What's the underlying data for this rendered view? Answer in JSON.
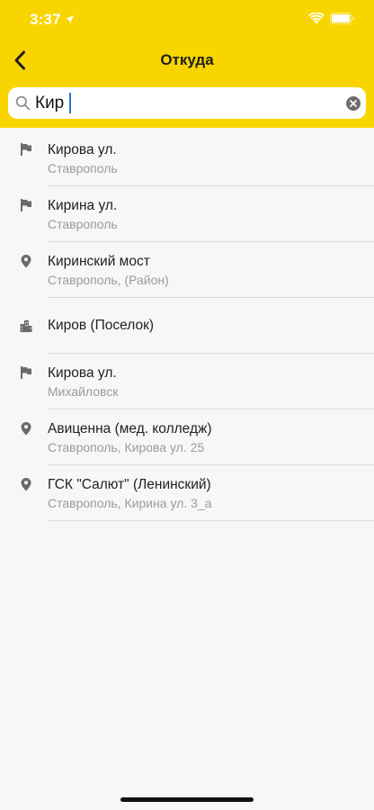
{
  "status_bar": {
    "time": "3:37"
  },
  "nav": {
    "title": "Откуда"
  },
  "search": {
    "value": "Кир"
  },
  "results": [
    {
      "icon": "flag-icon",
      "title": "Кирова ул.",
      "subtitle": "Ставрополь"
    },
    {
      "icon": "flag-icon",
      "title": "Кирина ул.",
      "subtitle": "Ставрополь"
    },
    {
      "icon": "pin-icon",
      "title": "Киринский мост",
      "subtitle": "Ставрополь, (Район)"
    },
    {
      "icon": "city-icon",
      "title": "Киров (Поселок)",
      "subtitle": ""
    },
    {
      "icon": "flag-icon",
      "title": "Кирова ул.",
      "subtitle": "Михайловск"
    },
    {
      "icon": "pin-icon",
      "title": "Авиценна (мед. колледж)",
      "subtitle": "Ставрополь, Кирова ул. 25"
    },
    {
      "icon": "pin-icon",
      "title": "ГСК \"Салют\" (Ленинский)",
      "subtitle": "Ставрополь, Кирина ул. 3_а"
    }
  ],
  "colors": {
    "header": "#f8d500",
    "background": "#f7f7f7",
    "caret": "#2f6fe6",
    "icon": "#6b6b6b"
  }
}
